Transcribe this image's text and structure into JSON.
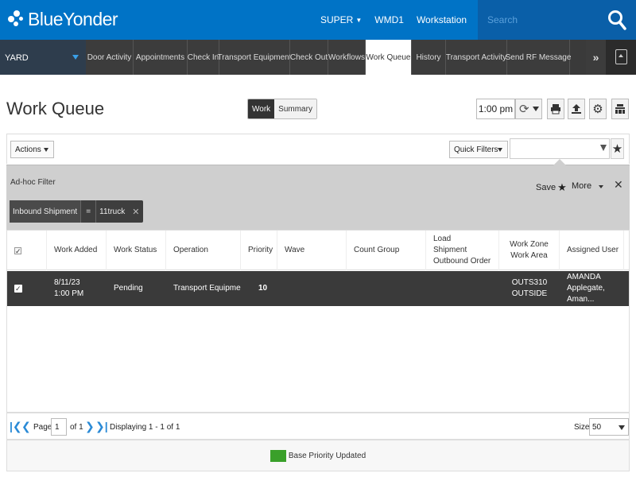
{
  "app": {
    "brand": "BlueYonder",
    "user_menu": "SUPER",
    "warehouse": "WMD1",
    "workstation": "Workstation",
    "help": "?",
    "search_placeholder": "Search"
  },
  "nav": {
    "context": "YARD",
    "tabs": [
      {
        "label": "Door Activity",
        "w": 60
      },
      {
        "label": "Appointments",
        "w": 68
      },
      {
        "label": "Check In",
        "w": 40
      },
      {
        "label": "Transport Equipment",
        "w": 89
      },
      {
        "label": "Check Out",
        "w": 48
      },
      {
        "label": "Workflows",
        "w": 47
      },
      {
        "label": "Work Queue",
        "w": 58
      },
      {
        "label": "History",
        "w": 43
      },
      {
        "label": "Transport Activity",
        "w": 77
      },
      {
        "label": "Send RF Message",
        "w": 79
      }
    ],
    "active_tab": "Work Queue",
    "more": "»"
  },
  "header": {
    "title": "Work Queue",
    "toggle_work": "Work",
    "toggle_summary": "Summary",
    "time": "1:00 pm"
  },
  "actions": {
    "actions_label": "Actions",
    "quick_filters_label": "Quick Filters",
    "filter_value": ""
  },
  "adhoc": {
    "title": "Ad-hoc Filter",
    "chip_field": "Inbound Shipment",
    "chip_operator": "=",
    "chip_value": "11truck",
    "save_label": "Save",
    "more_label": "More"
  },
  "grid": {
    "columns": [
      {
        "label": "",
        "w": 50
      },
      {
        "label": "Work Added",
        "w": 75
      },
      {
        "label": "Work Status",
        "w": 75
      },
      {
        "label": "Operation",
        "w": 94
      },
      {
        "label": "Priority",
        "w": 46
      },
      {
        "label": "Wave",
        "w": 87
      },
      {
        "label": "Count Group",
        "w": 100
      },
      {
        "label": "Load\nShipment\nOutbound Order",
        "w": 92
      },
      {
        "label": "Work Zone\nWork Area",
        "w": 76
      },
      {
        "label": "Assigned User",
        "w": 81
      }
    ],
    "rows": [
      {
        "work_added": "8/11/23\n1:00 PM",
        "work_status": "Pending",
        "operation": "Transport Equipmer",
        "priority": "10",
        "wave": "",
        "count_group": "",
        "load": "",
        "zone": "OUTS310\nOUTSIDE",
        "user": "AMANDA\nApplegate, Aman..."
      }
    ]
  },
  "pager": {
    "page_label": "Page",
    "page_value": "1",
    "of_label": "of 1",
    "displaying": "Displaying 1 - 1 of 1",
    "size_label": "Size",
    "size_value": "50"
  },
  "status": {
    "message": "Base Priority Updated",
    "color": "#3aa02a"
  },
  "colors": {
    "brand_blue": "#0073c6",
    "nav_dark": "#3a3a3a",
    "accent_blue": "#2a8ad6"
  }
}
